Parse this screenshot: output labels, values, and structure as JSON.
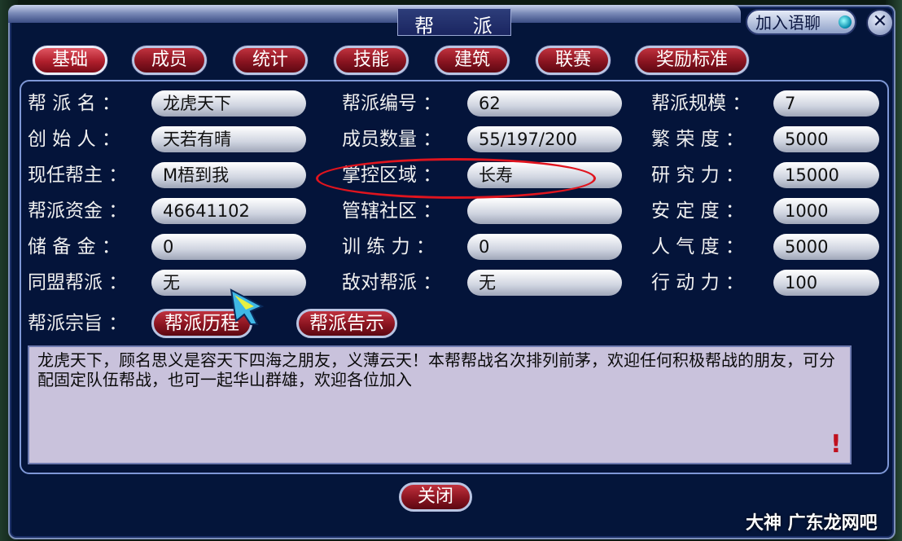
{
  "window": {
    "title": "帮 派",
    "chat_button": "加入语聊",
    "close_glyph": "✕"
  },
  "tabs": [
    {
      "label": "基础",
      "active": true
    },
    {
      "label": "成员"
    },
    {
      "label": "统计"
    },
    {
      "label": "技能"
    },
    {
      "label": "建筑"
    },
    {
      "label": "联赛"
    },
    {
      "label": "奖励标准"
    }
  ],
  "info": {
    "col1": [
      {
        "label": "帮 派 名 ：",
        "value": "龙虎天下"
      },
      {
        "label": "创 始 人 ：",
        "value": "天若有晴"
      },
      {
        "label": "现任帮主 ：",
        "value": "M梧到我"
      },
      {
        "label": "帮派资金 ：",
        "value": "46641102"
      },
      {
        "label": "储 备 金 ：",
        "value": "0"
      },
      {
        "label": "同盟帮派 ：",
        "value": "无"
      }
    ],
    "col2": [
      {
        "label": "帮派编号 ：",
        "value": "62"
      },
      {
        "label": "成员数量 ：",
        "value": "55/197/200"
      },
      {
        "label": "掌控区域 ：",
        "value": "长寿"
      },
      {
        "label": "管辖社区 ：",
        "value": ""
      },
      {
        "label": "训 练 力 ：",
        "value": "0"
      },
      {
        "label": "敌对帮派 ：",
        "value": "无"
      }
    ],
    "col3": [
      {
        "label": "帮派规模 ：",
        "value": "7"
      },
      {
        "label": "繁 荣 度 ：",
        "value": "5000"
      },
      {
        "label": "研 究 力 ：",
        "value": "15000"
      },
      {
        "label": "安 定 度 ：",
        "value": "1000"
      },
      {
        "label": "人 气 度 ：",
        "value": "5000"
      },
      {
        "label": "行 动 力 ：",
        "value": "100"
      }
    ]
  },
  "purpose": {
    "label": "帮派宗旨 ：",
    "history_button": "帮派历程",
    "notice_button": "帮派告示",
    "text": "龙虎天下，顾名思义是容天下四海之朋友，义薄云天！本帮帮战名次排列前茅，欢迎任何积极帮战的朋友，可分配固定队伍帮战，也可一起华山群雄，欢迎各位加入",
    "alert_glyph": "!"
  },
  "footer": {
    "close_button": "关闭"
  },
  "watermark": "大神 广东龙网吧",
  "colors": {
    "window_bg": "#04153a",
    "tab_red": "#8a1420",
    "highlight": "#e0141e"
  }
}
